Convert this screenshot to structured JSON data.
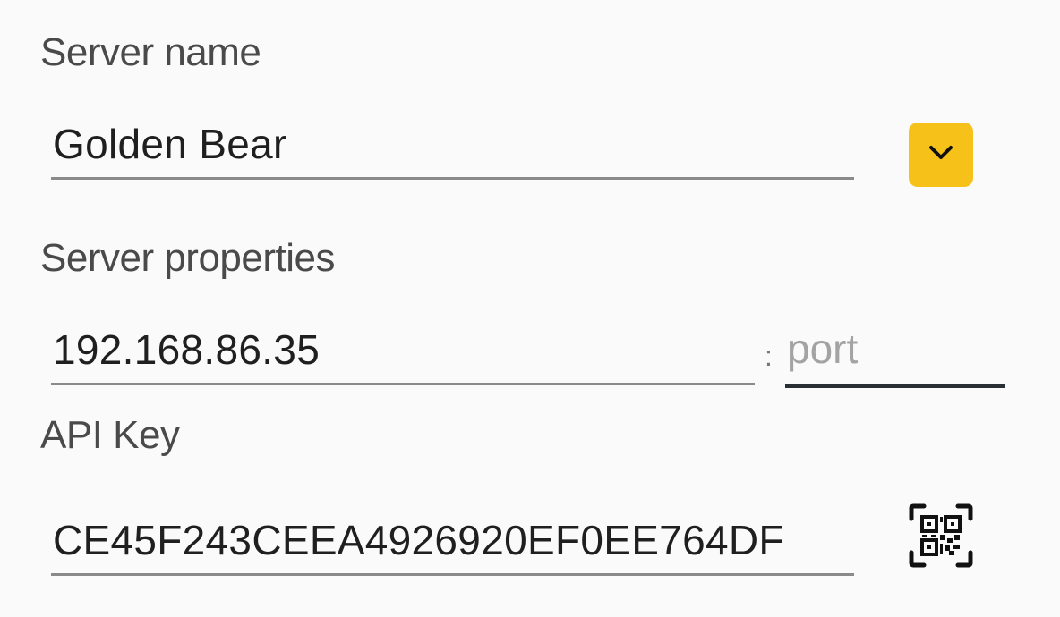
{
  "server_name": {
    "label": "Server name",
    "value": "Golden Bear",
    "dropdown_icon": "chevron-down-icon",
    "accent_color": "#f6c21a"
  },
  "server_properties": {
    "label": "Server properties",
    "host_value": "192.168.86.35",
    "separator": ":",
    "port_placeholder": "port"
  },
  "api_key": {
    "label": "API Key",
    "value": "CE45F243CEEA4926920EF0EE764DF",
    "scan_icon": "qr-code-scan-icon"
  }
}
